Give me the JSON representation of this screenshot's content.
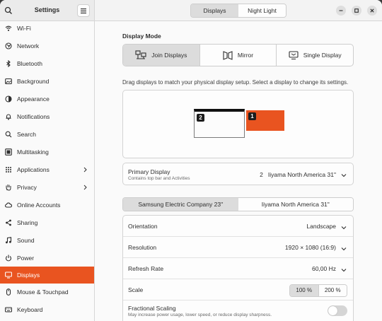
{
  "header": {
    "title": "Settings",
    "tabs": [
      {
        "label": "Displays",
        "active": true
      },
      {
        "label": "Night Light",
        "active": false
      }
    ]
  },
  "sidebar": {
    "active_color": "#e95420",
    "items": [
      {
        "label": "Wi-Fi",
        "icon": "wifi-icon"
      },
      {
        "label": "Network",
        "icon": "network-icon"
      },
      {
        "label": "Bluetooth",
        "icon": "bluetooth-icon"
      },
      {
        "label": "Background",
        "icon": "background-icon"
      },
      {
        "label": "Appearance",
        "icon": "appearance-icon"
      },
      {
        "label": "Notifications",
        "icon": "bell-icon"
      },
      {
        "label": "Search",
        "icon": "search-icon"
      },
      {
        "label": "Multitasking",
        "icon": "multitasking-icon"
      },
      {
        "label": "Applications",
        "icon": "apps-grid-icon",
        "submenu": true
      },
      {
        "label": "Privacy",
        "icon": "hand-icon",
        "submenu": true
      },
      {
        "label": "Online Accounts",
        "icon": "cloud-icon"
      },
      {
        "label": "Sharing",
        "icon": "share-icon"
      },
      {
        "label": "Sound",
        "icon": "music-note-icon"
      },
      {
        "label": "Power",
        "icon": "power-icon"
      },
      {
        "label": "Displays",
        "icon": "display-icon",
        "active": true
      },
      {
        "label": "Mouse & Touchpad",
        "icon": "mouse-icon"
      },
      {
        "label": "Keyboard",
        "icon": "keyboard-icon"
      }
    ]
  },
  "display_mode": {
    "title": "Display Mode",
    "options": [
      {
        "label": "Join Displays",
        "icon": "join-displays-icon",
        "active": true
      },
      {
        "label": "Mirror",
        "icon": "mirror-icon",
        "active": false
      },
      {
        "label": "Single Display",
        "icon": "single-display-icon",
        "active": false
      }
    ]
  },
  "arrangement": {
    "hint": "Drag displays to match your physical display setup. Select a display to change its settings.",
    "monitors": [
      {
        "number": "2",
        "primary": true
      },
      {
        "number": "1",
        "primary": false
      }
    ]
  },
  "primary_display": {
    "label": "Primary Display",
    "subtitle": "Contains top bar and Activities",
    "value": "2   Iiyama North America 31\""
  },
  "monitor_tabs": [
    {
      "label": "Samsung Electric Company 23\"",
      "active": true
    },
    {
      "label": "Iiyama North America 31\"",
      "active": false
    }
  ],
  "settings": {
    "orientation": {
      "label": "Orientation",
      "value": "Landscape"
    },
    "resolution": {
      "label": "Resolution",
      "value": "1920 × 1080 (16:9)"
    },
    "refresh_rate": {
      "label": "Refresh Rate",
      "value": "60,00 Hz"
    },
    "scale": {
      "label": "Scale",
      "options": [
        "100 %",
        "200 %"
      ],
      "selected": "100 %"
    },
    "fractional_scaling": {
      "label": "Fractional Scaling",
      "subtitle": "May increase power usage, lower speed, or reduce display sharpness.",
      "enabled": false
    }
  }
}
